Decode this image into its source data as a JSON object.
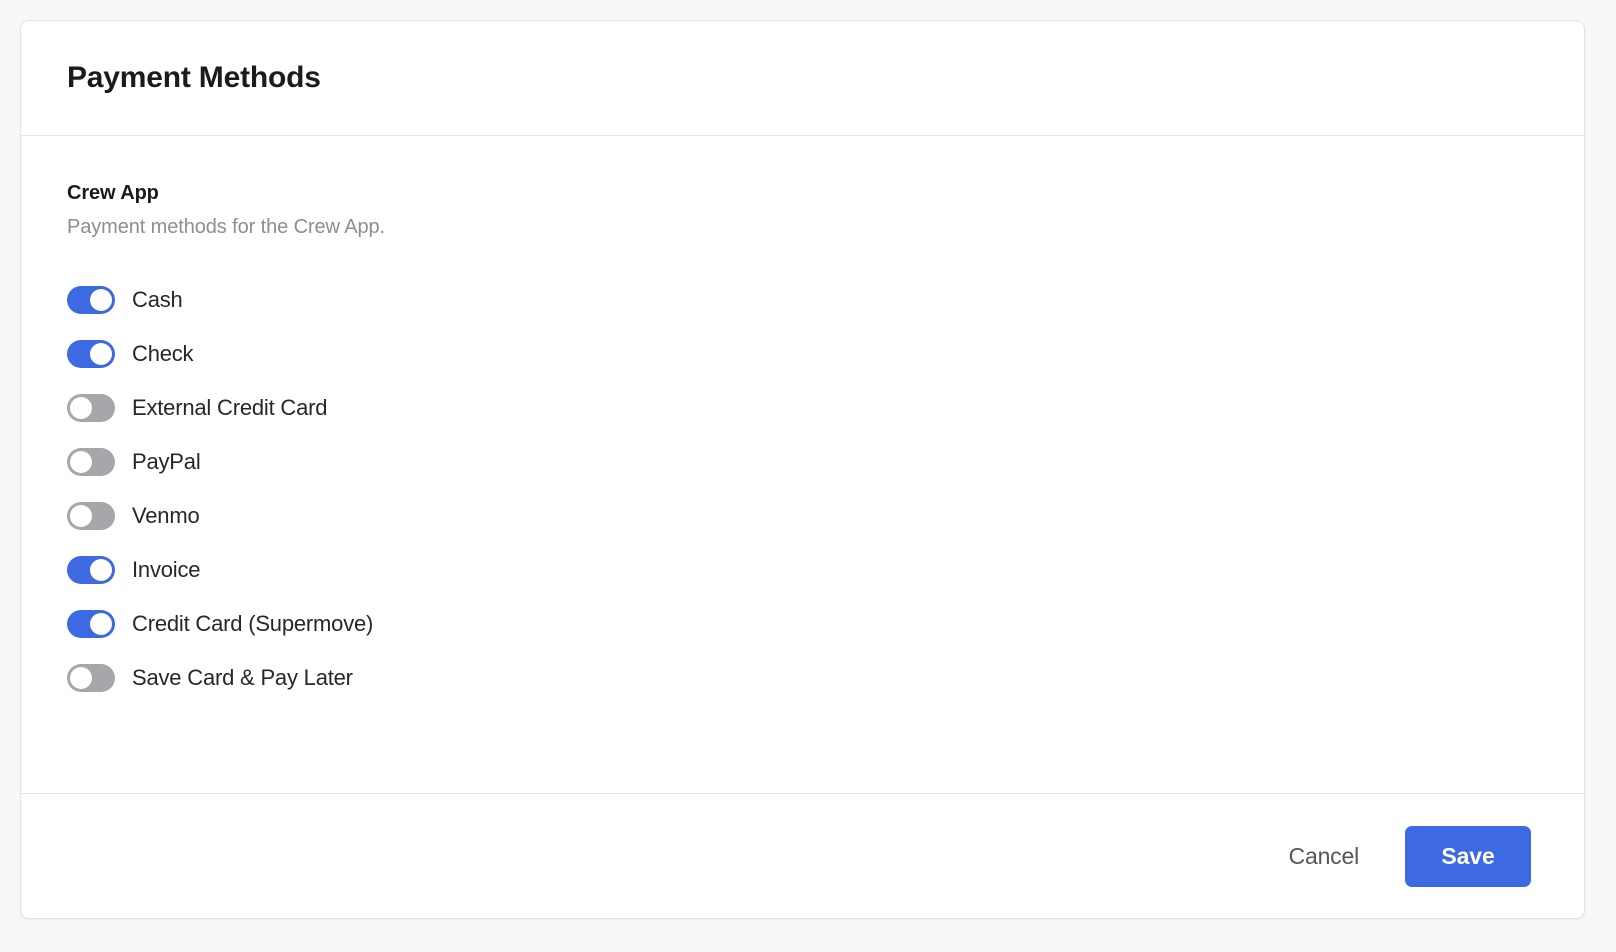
{
  "card": {
    "header": {
      "title": "Payment Methods"
    },
    "section": {
      "title": "Crew App",
      "subtitle": "Payment methods for the Crew App."
    },
    "payment_methods": [
      {
        "label": "Cash",
        "enabled": true
      },
      {
        "label": "Check",
        "enabled": true
      },
      {
        "label": "External Credit Card",
        "enabled": false
      },
      {
        "label": "PayPal",
        "enabled": false
      },
      {
        "label": "Venmo",
        "enabled": false
      },
      {
        "label": "Invoice",
        "enabled": true
      },
      {
        "label": "Credit Card (Supermove)",
        "enabled": true
      },
      {
        "label": "Save Card & Pay Later",
        "enabled": false
      }
    ],
    "footer": {
      "cancel_label": "Cancel",
      "save_label": "Save"
    }
  },
  "colors": {
    "toggle_on": "#3d6ae3",
    "toggle_off": "#a7a7ab",
    "primary_button": "#3d6ae3",
    "annotation_highlight": "#e8391b",
    "page_background": "#f8f8f9",
    "card_background": "#ffffff",
    "divider": "#e3e3e4"
  }
}
